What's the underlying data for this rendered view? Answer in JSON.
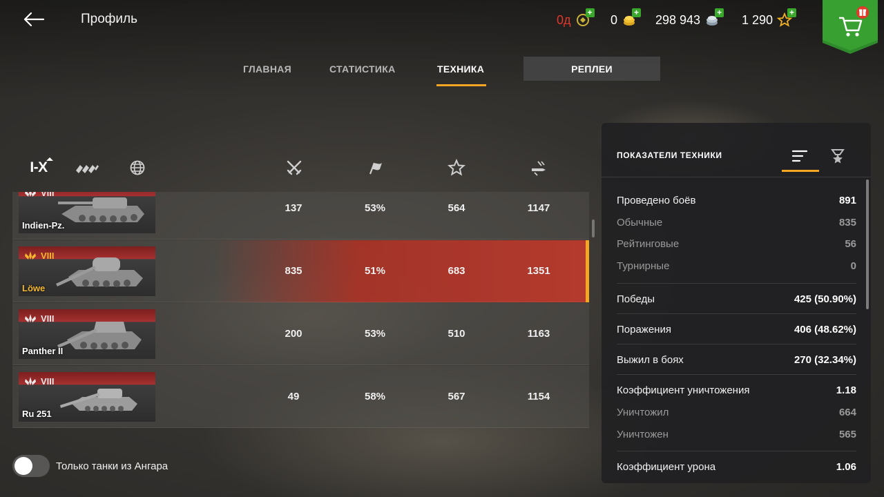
{
  "header": {
    "title": "Профиль",
    "currencies": [
      {
        "name": "free-xp",
        "value": "0д",
        "color": "#e0372c"
      },
      {
        "name": "gold",
        "value": "0"
      },
      {
        "name": "credits",
        "value": "298 943"
      },
      {
        "name": "premium-xp",
        "value": "1 290"
      }
    ]
  },
  "tabs": {
    "main": "ГЛАВНАЯ",
    "statistics": "СТАТИСТИКА",
    "vehicles": "ТЕХНИКА",
    "replays": "РЕПЛЕИ"
  },
  "filters": {
    "tier": "I-X"
  },
  "vehicles": [
    {
      "tier": "VIII",
      "name": "Indien-Pz.",
      "battles": "137",
      "winrate": "53%",
      "avg_xp": "564",
      "avg_damage": "1147",
      "selected": false
    },
    {
      "tier": "VIII",
      "name": "Löwe",
      "battles": "835",
      "winrate": "51%",
      "avg_xp": "683",
      "avg_damage": "1351",
      "selected": true
    },
    {
      "tier": "VIII",
      "name": "Panther II",
      "battles": "200",
      "winrate": "53%",
      "avg_xp": "510",
      "avg_damage": "1163",
      "selected": false
    },
    {
      "tier": "VIII",
      "name": "Ru 251",
      "battles": "49",
      "winrate": "58%",
      "avg_xp": "567",
      "avg_damage": "1154",
      "selected": false
    }
  ],
  "hangar_toggle": {
    "label": "Только танки из Ангара",
    "on": false
  },
  "stats_panel": {
    "title": "ПОКАЗАТЕЛИ ТЕХНИКИ",
    "rows": [
      {
        "label": "Проведено боёв",
        "value": "891"
      },
      {
        "label": "Обычные",
        "value": "835"
      },
      {
        "label": "Рейтинговые",
        "value": "56"
      },
      {
        "label": "Турнирные",
        "value": "0"
      },
      {
        "label": "Победы",
        "value": "425 (50.90%)"
      },
      {
        "label": "Поражения",
        "value": "406 (48.62%)"
      },
      {
        "label": "Выжил в боях",
        "value": "270 (32.34%)"
      },
      {
        "label": "Коэффициент уничтожения",
        "value": "1.18"
      },
      {
        "label": "Уничтожил",
        "value": "664"
      },
      {
        "label": "Уничтожен",
        "value": "565"
      },
      {
        "label": "Коэффициент урона",
        "value": "1.06"
      }
    ]
  },
  "colors": {
    "accent": "#f5a623",
    "selected_row": "#be3a2d",
    "gold_name": "#f5b82e"
  }
}
